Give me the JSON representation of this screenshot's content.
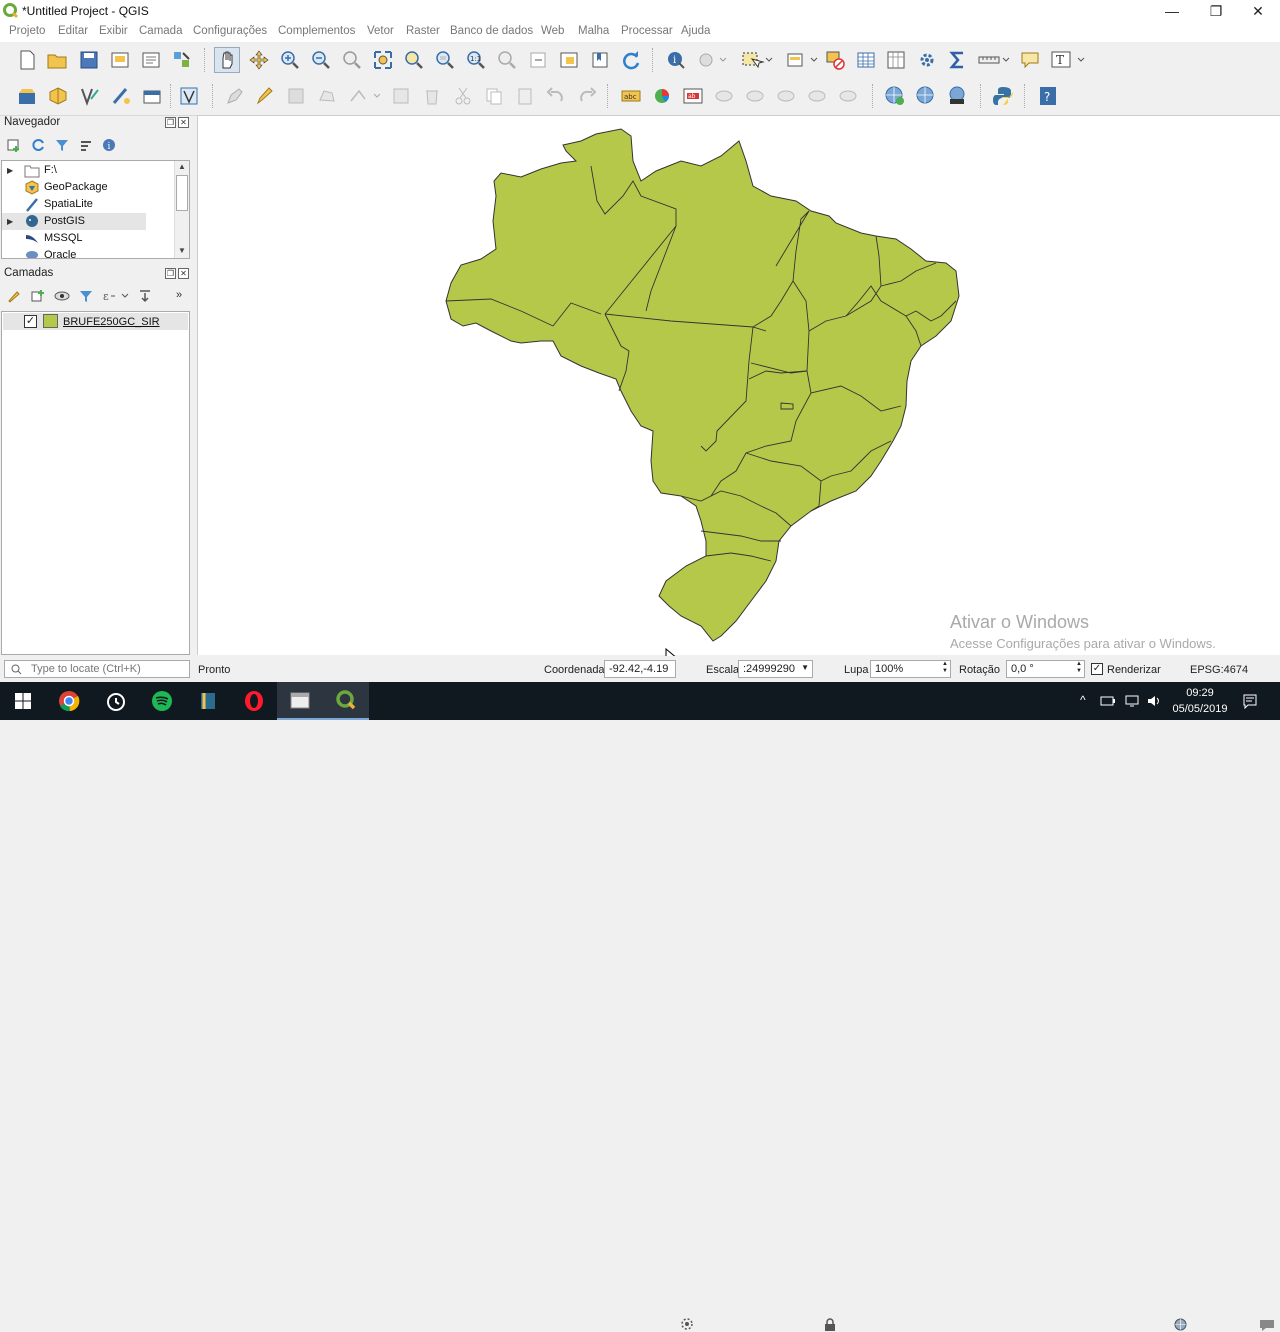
{
  "window": {
    "title": "*Untitled Project - QGIS",
    "minimize": "—",
    "restore": "❐",
    "close": "✕"
  },
  "menu": [
    "Projeto",
    "Editar",
    "Exibir",
    "Camada",
    "Configurações",
    "Complementos",
    "Vetor",
    "Raster",
    "Banco de dados",
    "Web",
    "Malha",
    "Processar",
    "Ajuda"
  ],
  "browser": {
    "title": "Navegador",
    "items": [
      {
        "label": "F:\\",
        "icon": "folder-icon",
        "expandable": true
      },
      {
        "label": "GeoPackage",
        "icon": "geopackage-icon",
        "expandable": false
      },
      {
        "label": "SpatiaLite",
        "icon": "spatialite-icon",
        "expandable": false
      },
      {
        "label": "PostGIS",
        "icon": "postgis-icon",
        "expandable": true
      },
      {
        "label": "MSSQL",
        "icon": "mssql-icon",
        "expandable": false
      },
      {
        "label": "Oracle",
        "icon": "oracle-icon",
        "expandable": false
      }
    ]
  },
  "layers": {
    "title": "Camadas",
    "items": [
      {
        "label": "BRUFE250GC_SIR",
        "checked": true,
        "color": "#b5c84a"
      }
    ]
  },
  "map": {
    "fill_color": "#b5c84a",
    "watermark_title": "Ativar o Windows",
    "watermark_subtitle": "Acesse Configurações para ativar o Windows."
  },
  "status": {
    "locate_placeholder": "Type to locate (Ctrl+K)",
    "message": "Pronto",
    "coordinate_label": "Coordenada",
    "coordinate_value": "-92.42,-4.19",
    "scale_label": "Escala",
    "scale_value": ":24999290",
    "magnifier_label": "Lupa",
    "magnifier_value": "100%",
    "rotation_label": "Rotação",
    "rotation_value": "0,0 °",
    "render_label": "Renderizar",
    "render_checked": true,
    "crs": "EPSG:4674"
  },
  "taskbar": {
    "time": "09:29",
    "date": "05/05/2019",
    "apps": [
      "windows-start-icon",
      "chrome-icon",
      "clock-app-icon",
      "spotify-icon",
      "app-icon",
      "opera-icon",
      "file-explorer-icon",
      "qgis-icon"
    ]
  }
}
